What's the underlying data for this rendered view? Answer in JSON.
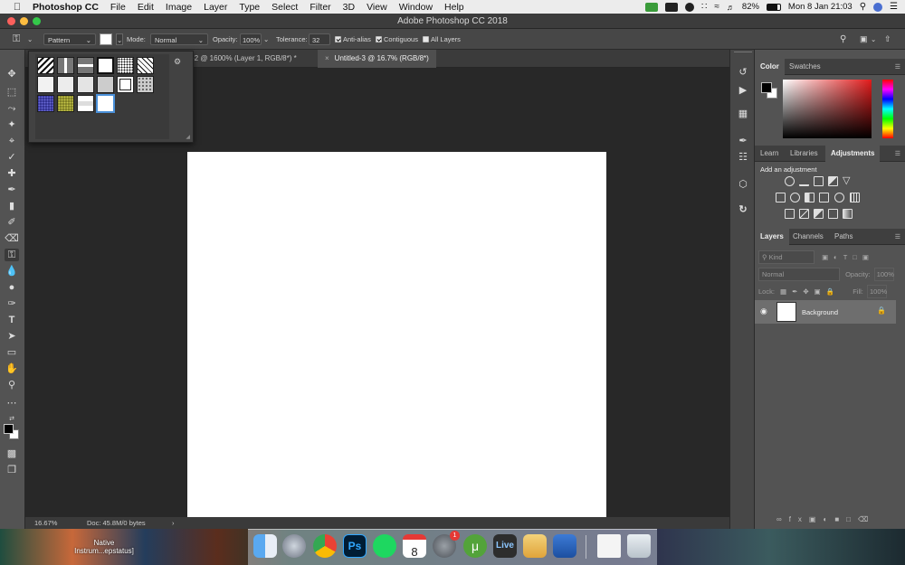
{
  "menubar": {
    "app": "Photoshop CC",
    "items": [
      "File",
      "Edit",
      "Image",
      "Layer",
      "Type",
      "Select",
      "Filter",
      "3D",
      "View",
      "Window",
      "Help"
    ],
    "battery": "82%",
    "datetime": "Mon 8 Jan  21:03"
  },
  "window": {
    "title": "Adobe Photoshop CC 2018"
  },
  "options": {
    "fill_source": "Pattern",
    "mode_label": "Mode:",
    "mode": "Normal",
    "opacity_label": "Opacity:",
    "opacity": "100%",
    "tolerance_label": "Tolerance:",
    "tolerance": "32",
    "antialias": "Anti-alias",
    "contiguous": "Contiguous",
    "all_layers": "All Layers"
  },
  "tabs": [
    {
      "label": "-2 @ 1600% (Layer 1, RGB/8*) *"
    },
    {
      "label": "Untitled-3 @ 16.7% (RGB/8*)"
    }
  ],
  "status": {
    "zoom": "16.67%",
    "doc": "Doc: 45.8M/0 bytes"
  },
  "panels": {
    "color_tabs": [
      "Color",
      "Swatches"
    ],
    "adjust_tabs": [
      "Learn",
      "Libraries",
      "Adjustments"
    ],
    "add_adjustment": "Add an adjustment",
    "layer_tabs": [
      "Layers",
      "Channels",
      "Paths"
    ],
    "kind": "Kind",
    "blend": "Normal",
    "opacity_label": "Opacity:",
    "opacity": "100%",
    "lock_label": "Lock:",
    "fill_label": "Fill:",
    "fill": "100%",
    "layer_name": "Background"
  },
  "dock": {
    "label": "Native Instrum...epstatus]",
    "calendar_day": "8",
    "badge": "1",
    "live": "Live"
  },
  "colors": {
    "accent": "#4a90d9",
    "canvas": "#ffffff",
    "foreground": "#000000",
    "background": "#ffffff"
  }
}
